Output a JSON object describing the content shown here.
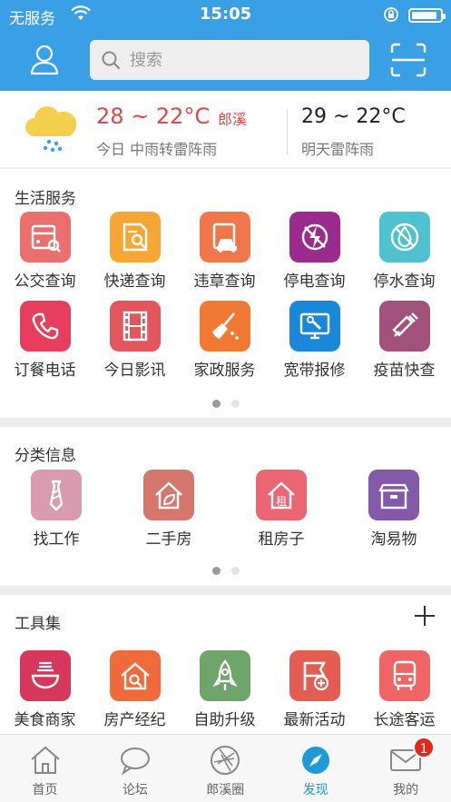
{
  "status": {
    "carrier": "无服务",
    "time": "15:05",
    "battery_level": 0.9
  },
  "search": {
    "placeholder": "搜索"
  },
  "weather": {
    "today_temp": "28 ~ 22°C",
    "city": "郎溪",
    "today_desc": "今日 中雨转雷阵雨",
    "tomorrow_temp": "29 ~ 22°C",
    "tomorrow_desc": "明天雷阵雨"
  },
  "life_services": {
    "title": "生活服务",
    "items": [
      {
        "label": "公交查询",
        "icon": "bus-card-icon",
        "color": "#ec6f6f"
      },
      {
        "label": "快递查询",
        "icon": "package-search-icon",
        "color": "#f6a733"
      },
      {
        "label": "违章查询",
        "icon": "car-ticket-icon",
        "color": "#f0774a"
      },
      {
        "label": "停电查询",
        "icon": "power-off-icon",
        "color": "#9b2b8e"
      },
      {
        "label": "停水查询",
        "icon": "water-off-icon",
        "color": "#4fc1cf"
      },
      {
        "label": "订餐电话",
        "icon": "phone-icon",
        "color": "#e83e5d"
      },
      {
        "label": "今日影讯",
        "icon": "film-icon",
        "color": "#e4565e"
      },
      {
        "label": "家政服务",
        "icon": "broom-icon",
        "color": "#f07a33"
      },
      {
        "label": "宽带报修",
        "icon": "monitor-wrench-icon",
        "color": "#1a88d8"
      },
      {
        "label": "疫苗快查",
        "icon": "syringe-icon",
        "color": "#a0527a"
      }
    ]
  },
  "classified": {
    "title": "分类信息",
    "items": [
      {
        "label": "找工作",
        "icon": "tie-icon",
        "color": "#d99bb0"
      },
      {
        "label": "二手房",
        "icon": "house-leaf-icon",
        "color": "#d5776c"
      },
      {
        "label": "租房子",
        "icon": "house-rent-icon",
        "color": "#e96672"
      },
      {
        "label": "淘易物",
        "icon": "box-icon",
        "color": "#8459a7"
      }
    ]
  },
  "tools": {
    "title": "工具集",
    "items": [
      {
        "label": "美食商家",
        "icon": "bowl-icon",
        "color": "#d7375b"
      },
      {
        "label": "房产经纪",
        "icon": "house-search-icon",
        "color": "#f16a3c"
      },
      {
        "label": "自助升级",
        "icon": "rocket-icon",
        "color": "#6fa56a"
      },
      {
        "label": "最新活动",
        "icon": "flag-plus-icon",
        "color": "#e45d52"
      },
      {
        "label": "长途客运",
        "icon": "coach-icon",
        "color": "#ef6565"
      }
    ]
  },
  "tabs": [
    {
      "label": "首页",
      "icon": "home-icon"
    },
    {
      "label": "论坛",
      "icon": "chat-icon"
    },
    {
      "label": "郎溪圈",
      "icon": "aperture-icon"
    },
    {
      "label": "发现",
      "icon": "compass-icon",
      "active": true
    },
    {
      "label": "我的",
      "icon": "mail-icon",
      "badge": "1"
    }
  ]
}
